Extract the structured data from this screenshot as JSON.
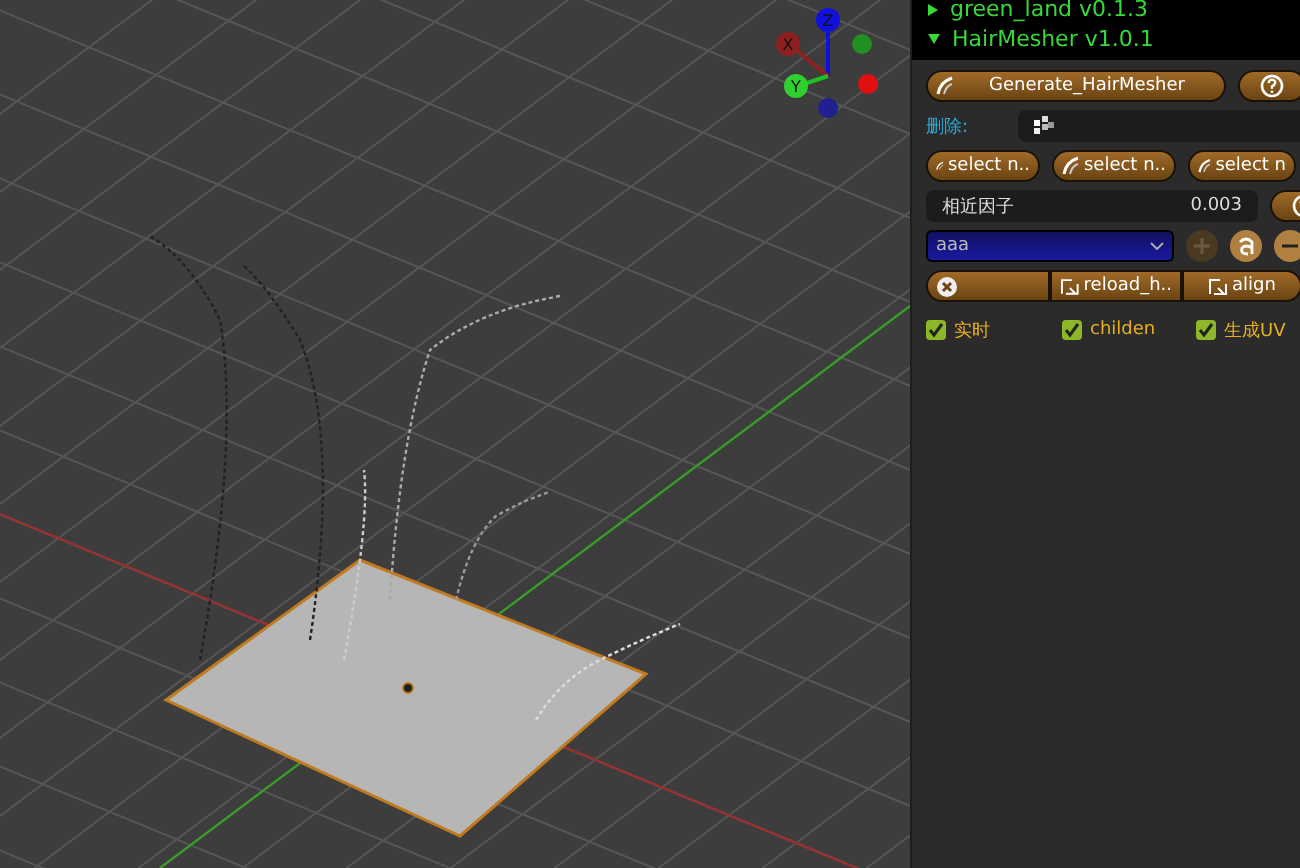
{
  "viewport": {
    "gizmo": {
      "axes": [
        "X",
        "Y",
        "Z"
      ]
    }
  },
  "panel": {
    "addons": [
      {
        "label": "green_land v0.1.3",
        "expanded": false
      },
      {
        "label": "HairMesher v1.0.1",
        "expanded": true
      }
    ],
    "generate_button": "Generate_HairMesher",
    "delete_field": {
      "label": "删除:"
    },
    "select_buttons": [
      "select n..",
      "select n..",
      "select n"
    ],
    "factor_field": {
      "label": "相近因子",
      "value": "0.003"
    },
    "dropdown": {
      "value": "aaa"
    },
    "actions": [
      {
        "kind": "icon"
      },
      {
        "kind": "text",
        "label": "reload_h.."
      },
      {
        "kind": "text",
        "label": "align"
      }
    ],
    "checkboxes": [
      {
        "label": "实时",
        "checked": true
      },
      {
        "label": "childen",
        "checked": true
      },
      {
        "label": "生成UV",
        "checked": true
      }
    ]
  }
}
